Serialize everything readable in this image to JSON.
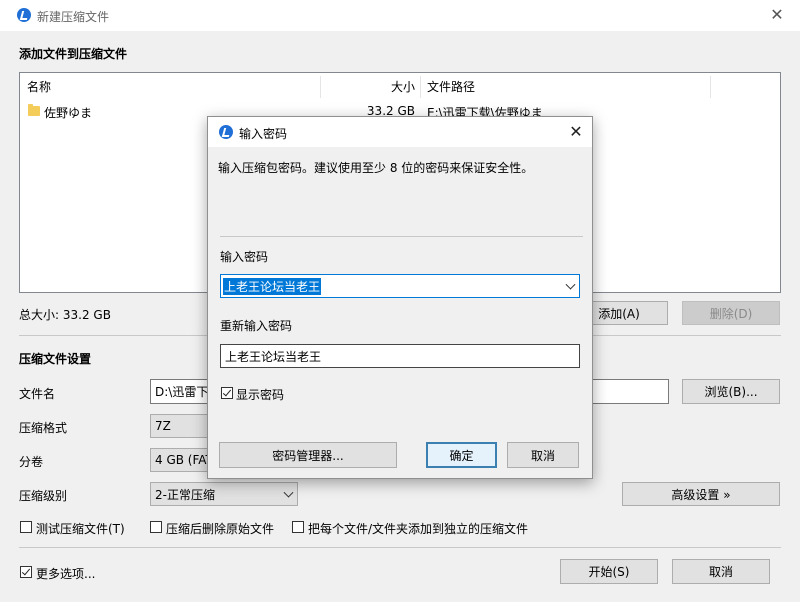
{
  "main": {
    "title": "新建压缩文件",
    "add_section_title": "添加文件到压缩文件",
    "columns": {
      "name": "名称",
      "size": "大小",
      "path": "文件路径"
    },
    "files": [
      {
        "name": "佐野ゆま",
        "size": "33.2 GB",
        "path": "E:\\迅雷下载\\佐野ゆま"
      }
    ],
    "total_size": "总大小: 33.2 GB",
    "add_button": "添加(A)",
    "delete_button": "删除(D)",
    "settings_title": "压缩文件设置",
    "filename_label": "文件名",
    "filename_value": "D:\\迅雷下",
    "browse_button": "浏览(B)...",
    "format_label": "压缩格式",
    "format_value": "7Z",
    "split_label": "分卷",
    "split_value": "4 GB (FAT",
    "level_label": "压缩级别",
    "level_value": "2-正常压缩",
    "advanced_button": "高级设置 »",
    "test_checkbox": "测试压缩文件(T)",
    "delete_after_checkbox": "压缩后删除原始文件",
    "each_separate_checkbox": "把每个文件/文件夹添加到独立的压缩文件",
    "more_options_checkbox": "更多选项...",
    "start_button": "开始(S)",
    "cancel_button": "取消"
  },
  "dialog": {
    "title": "输入密码",
    "description": "输入压缩包密码。建议使用至少 8 位的密码来保证安全性。",
    "password_label": "输入密码",
    "password_value": "上老王论坛当老王",
    "reenter_label": "重新输入密码",
    "reenter_value": "上老王论坛当老王",
    "show_password": "显示密码",
    "manager_button": "密码管理器...",
    "ok_button": "确定",
    "cancel_button": "取消"
  },
  "icons": {
    "app_logo": "app-logo-icon",
    "close": "close-icon",
    "folder": "folder-icon",
    "dropdown": "chevron-down-icon"
  },
  "colors": {
    "accent": "#0078d7",
    "logo": "#1f6fd6",
    "folder": "#f4cc59"
  }
}
